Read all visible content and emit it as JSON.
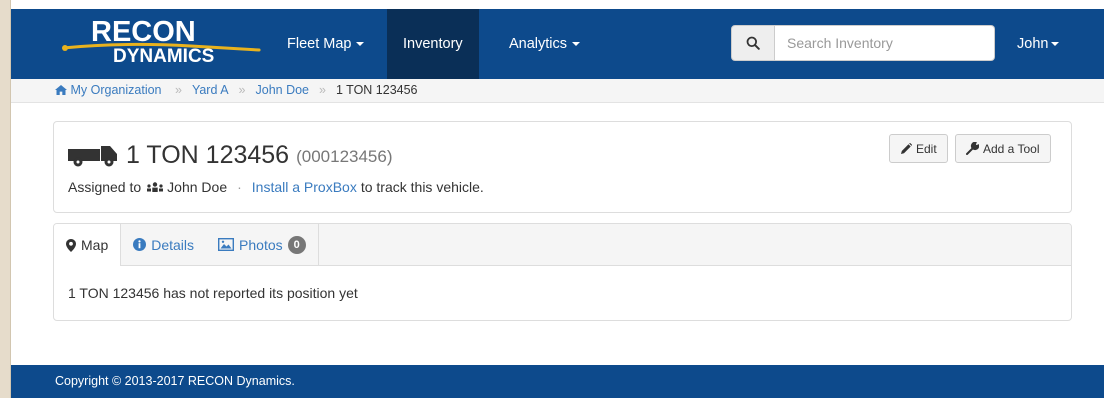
{
  "brand": {
    "line1": "RECON",
    "line2": "DYNAMICS"
  },
  "nav": {
    "items": [
      {
        "label": "Fleet Map",
        "dropdown": true
      },
      {
        "label": "Inventory",
        "active": true
      },
      {
        "label": "Analytics",
        "dropdown": true
      }
    ],
    "search_placeholder": "Search Inventory",
    "user": "John"
  },
  "breadcrumb": {
    "items": [
      "My Organization",
      "Yard A",
      "John Doe"
    ],
    "separator": "»",
    "current": "1 TON 123456"
  },
  "asset": {
    "name": "1 TON 123456",
    "id": "(000123456)",
    "assigned_prefix": "Assigned to",
    "assignee": "John Doe",
    "install_link": "Install a ProxBox",
    "install_suffix": "to track this vehicle."
  },
  "buttons": {
    "edit": "Edit",
    "add_tool": "Add a Tool"
  },
  "tabs": {
    "map": "Map",
    "details": "Details",
    "photos": "Photos",
    "photos_count": "0"
  },
  "map_message": "1 TON 123456 has not reported its position yet",
  "footer": {
    "copyright": "Copyright © 2013-2017 RECON Dynamics."
  },
  "colors": {
    "navbar": "#0d4a8c",
    "navbar_active": "#0a2f57",
    "link": "#3a7bbf",
    "logo_accent": "#e8b21e"
  }
}
